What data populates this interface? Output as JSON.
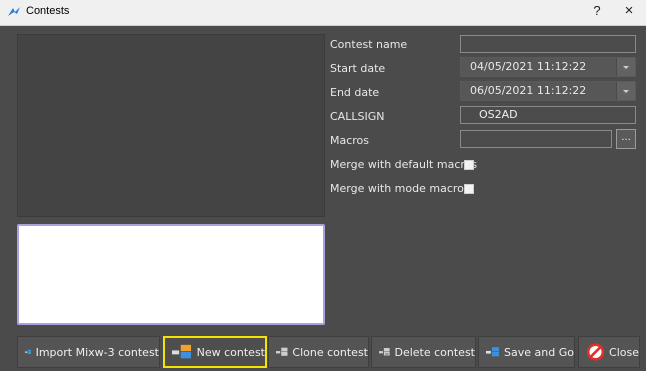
{
  "window": {
    "title": "Contests",
    "help_label": "?",
    "close_label": "×"
  },
  "form": {
    "contest_name": {
      "label": "Contest name",
      "value": ""
    },
    "start_date": {
      "label": "Start date",
      "value": "04/05/2021 11:12:22"
    },
    "end_date": {
      "label": "End date",
      "value": "06/05/2021 11:12:22"
    },
    "callsign": {
      "label": "CALLSIGN",
      "value": "OS2AD"
    },
    "macros": {
      "label": "Macros",
      "value": "",
      "browse_label": "..."
    },
    "merge_default": {
      "label": "Merge with default macros",
      "checked": false
    },
    "merge_mode": {
      "label": "Merge with mode macros",
      "checked": false
    }
  },
  "buttons": {
    "import": "Import Mixw-3 contest",
    "new": "New contest",
    "clone": "Clone contest",
    "delete": "Delete contest",
    "save_go": "Save and Go",
    "close": "Close"
  },
  "colors": {
    "background": "#4b4b4b",
    "highlight": "#f5e400",
    "icon_blue": "#3d8fe0",
    "icon_orange": "#f2a12a",
    "close_red": "#e0302a"
  }
}
